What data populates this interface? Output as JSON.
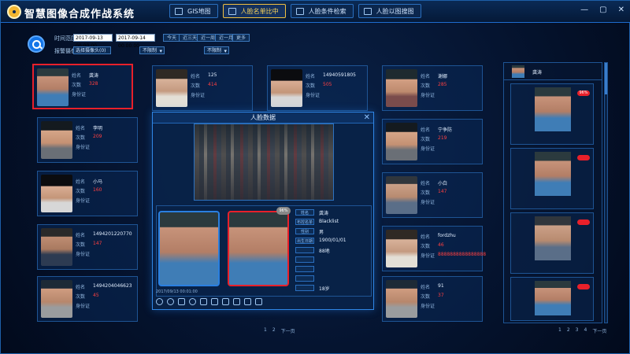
{
  "app": {
    "title": "智慧图像合成作战系统"
  },
  "tabs": [
    {
      "label": "GIS地图",
      "active": false
    },
    {
      "label": "人脸名单比中",
      "active": true
    },
    {
      "label": "人脸条件检索",
      "active": false
    },
    {
      "label": "人脸以图搜图",
      "active": false
    }
  ],
  "filters": {
    "time_label": "时间范围",
    "start": "2017-09-13 00:00:00",
    "end": "2017-09-14 00:00:00",
    "quick": [
      "今天",
      "近三天",
      "近一周",
      "近一月",
      "更多"
    ],
    "camera_label": "报警摄像头",
    "camera_value": "选择摄像头(0)",
    "sel1": "不限制",
    "sel2": "不限制"
  },
  "card_labels": {
    "name": "姓名",
    "count": "次数",
    "id": "身份证"
  },
  "cards": [
    {
      "name": "龚涛",
      "count": "328",
      "selected": true
    },
    {
      "name": "125",
      "count": "414"
    },
    {
      "name": "14940591805",
      "count": "505"
    },
    {
      "name": "谢娜",
      "count": "285"
    },
    {
      "name": "李明",
      "count": "209"
    },
    {
      "name": "宁争防",
      "count": "219"
    },
    {
      "name": "小马",
      "count": "160"
    },
    {
      "name": "小白",
      "count": "147"
    },
    {
      "name": "1494201220770",
      "count": "147"
    },
    {
      "name": "fordzhu",
      "count": "46",
      "extra": "8888888888888888"
    },
    {
      "name": "1494204046623",
      "count": "45"
    },
    {
      "name": "91",
      "count": "37"
    }
  ],
  "modal": {
    "title": "人脸数据",
    "percent": "96%",
    "labels": [
      "姓名",
      "布控名单",
      "性别",
      "出生日期"
    ],
    "values": [
      "龚涛",
      "Blacklist",
      "男",
      "1900/01/01"
    ],
    "value_extra": "88地",
    "footer_value": "18岁",
    "timestamp": "2017/09/13 00:01:00"
  },
  "sidebar": {
    "top_name": "龚涛",
    "items": [
      {
        "badge": "96%"
      },
      {
        "badge": ""
      },
      {
        "badge": ""
      },
      {
        "badge": ""
      }
    ]
  },
  "pager_left": [
    "1",
    "2",
    "下一页"
  ],
  "pager_right": [
    "1",
    "2",
    "3",
    "4",
    "下一页"
  ],
  "colors": {
    "accent": "#1e6ccf",
    "highlight": "#e8202a",
    "active_tab": "#f0c040"
  }
}
